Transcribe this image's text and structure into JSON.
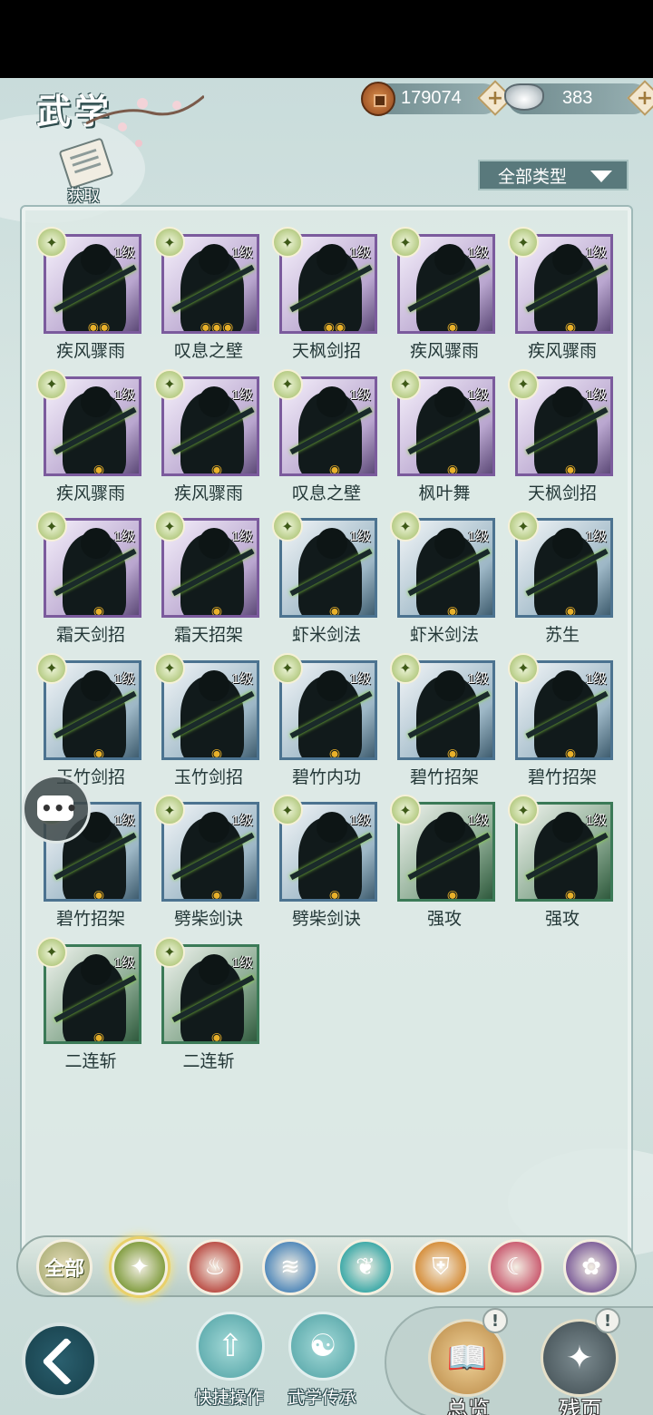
{
  "header": {
    "title": "武学",
    "copper": "179074",
    "silver": "383",
    "plus": "+",
    "obtain_label": "获取",
    "type_filter": "全部类型"
  },
  "skills": [
    {
      "name": "疾风骤雨",
      "level": "1级",
      "tier": "purple",
      "gems": "◉◉"
    },
    {
      "name": "叹息之壁",
      "level": "1级",
      "tier": "purple",
      "gems": "◉◉◉"
    },
    {
      "name": "天枫剑招",
      "level": "1级",
      "tier": "purple",
      "gems": "◉◉"
    },
    {
      "name": "疾风骤雨",
      "level": "1级",
      "tier": "purple",
      "gems": "◉"
    },
    {
      "name": "疾风骤雨",
      "level": "1级",
      "tier": "purple",
      "gems": "◉"
    },
    {
      "name": "疾风骤雨",
      "level": "1级",
      "tier": "purple",
      "gems": "◉"
    },
    {
      "name": "疾风骤雨",
      "level": "1级",
      "tier": "purple",
      "gems": "◉"
    },
    {
      "name": "叹息之壁",
      "level": "1级",
      "tier": "purple",
      "gems": "◉"
    },
    {
      "name": "枫叶舞",
      "level": "1级",
      "tier": "purple",
      "gems": "◉"
    },
    {
      "name": "天枫剑招",
      "level": "1级",
      "tier": "purple",
      "gems": "◉"
    },
    {
      "name": "霜天剑招",
      "level": "1级",
      "tier": "purple",
      "gems": "◉"
    },
    {
      "name": "霜天招架",
      "level": "1级",
      "tier": "purple",
      "gems": "◉"
    },
    {
      "name": "虾米剑法",
      "level": "1级",
      "tier": "blue",
      "gems": "◉"
    },
    {
      "name": "虾米剑法",
      "level": "1级",
      "tier": "blue",
      "gems": "◉"
    },
    {
      "name": "苏生",
      "level": "1级",
      "tier": "blue",
      "gems": "◉"
    },
    {
      "name": "玉竹剑招",
      "level": "1级",
      "tier": "blue",
      "gems": "◉"
    },
    {
      "name": "玉竹剑招",
      "level": "1级",
      "tier": "blue",
      "gems": "◉"
    },
    {
      "name": "碧竹内功",
      "level": "1级",
      "tier": "blue",
      "gems": "◉"
    },
    {
      "name": "碧竹招架",
      "level": "1级",
      "tier": "blue",
      "gems": "◉"
    },
    {
      "name": "碧竹招架",
      "level": "1级",
      "tier": "blue",
      "gems": "◉"
    },
    {
      "name": "碧竹招架",
      "level": "1级",
      "tier": "blue",
      "gems": "◉"
    },
    {
      "name": "劈柴剑诀",
      "level": "1级",
      "tier": "blue",
      "gems": "◉"
    },
    {
      "name": "劈柴剑诀",
      "level": "1级",
      "tier": "blue",
      "gems": "◉"
    },
    {
      "name": "强攻",
      "level": "1级",
      "tier": "green",
      "gems": "◉"
    },
    {
      "name": "强攻",
      "level": "1级",
      "tier": "green",
      "gems": "◉"
    },
    {
      "name": "二连斩",
      "level": "1级",
      "tier": "green",
      "gems": "◉"
    },
    {
      "name": "二连斩",
      "level": "1级",
      "tier": "green",
      "gems": "◉"
    }
  ],
  "chat_glyph": "•••",
  "sects": [
    {
      "label": "全部",
      "icon": "all-icon",
      "color": "#a0a56a"
    },
    {
      "label": "",
      "icon": "sword-wing-icon",
      "color": "#7d9a3a"
    },
    {
      "label": "",
      "icon": "flame-icon",
      "color": "#b8473f"
    },
    {
      "label": "",
      "icon": "wave-icon",
      "color": "#4a84b8"
    },
    {
      "label": "",
      "icon": "butterfly-icon",
      "color": "#35a6a5"
    },
    {
      "label": "",
      "icon": "shield-icon",
      "color": "#d48a34"
    },
    {
      "label": "",
      "icon": "moon-icon",
      "color": "#c8556b"
    },
    {
      "label": "",
      "icon": "peony-icon",
      "color": "#7a5a97"
    }
  ],
  "bottom": {
    "quick_ops": "快捷操作",
    "inherit": "武学传承",
    "overview": "总览",
    "fragments": "残页",
    "alert": "!"
  }
}
